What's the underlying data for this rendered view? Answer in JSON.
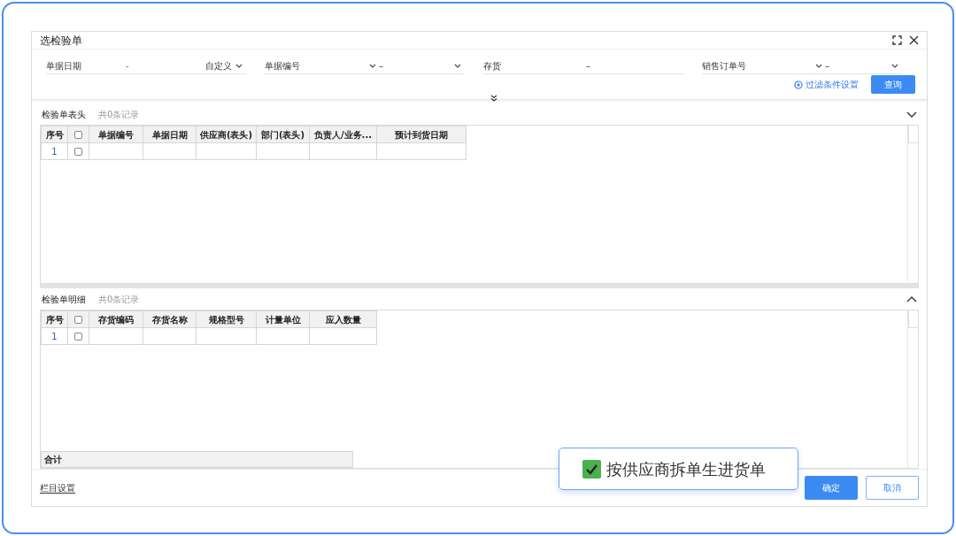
{
  "dialog": {
    "title": "选检验单"
  },
  "filters": [
    {
      "label": "单据日期",
      "kind": "date",
      "separator": "-",
      "mode": "自定义"
    },
    {
      "label": "单据编号",
      "kind": "select-range",
      "separator": "–"
    },
    {
      "label": "存货",
      "kind": "range",
      "separator": "–"
    },
    {
      "label": "销售订单号",
      "kind": "select-range",
      "separator": "–"
    }
  ],
  "filter_settings": "过滤条件设置",
  "query_button": "查询",
  "sections": [
    {
      "title": "检验单表头",
      "count": "共0条记录",
      "expanded": true,
      "all_checked": false,
      "index_header": "序号",
      "columns": [
        "单据编号",
        "单据日期",
        "供应商(表头)",
        "部门(表头)",
        "负责人/业务...",
        "预计到货日期"
      ],
      "rows": [
        {
          "index": "1",
          "checked": false
        }
      ]
    },
    {
      "title": "检验单明细",
      "count": "共0条记录",
      "expanded": false,
      "all_checked": false,
      "index_header": "序号",
      "columns": [
        "存货编码",
        "存货名称",
        "规格型号",
        "计量单位",
        "应入数量"
      ],
      "rows": [
        {
          "index": "1",
          "checked": false
        }
      ],
      "total_label": "合计"
    }
  ],
  "column_settings": "栏目设置",
  "ok_button": "确定",
  "cancel_button": "取消",
  "callout": {
    "label": "按供应商拆单生进货单",
    "checked": true
  }
}
